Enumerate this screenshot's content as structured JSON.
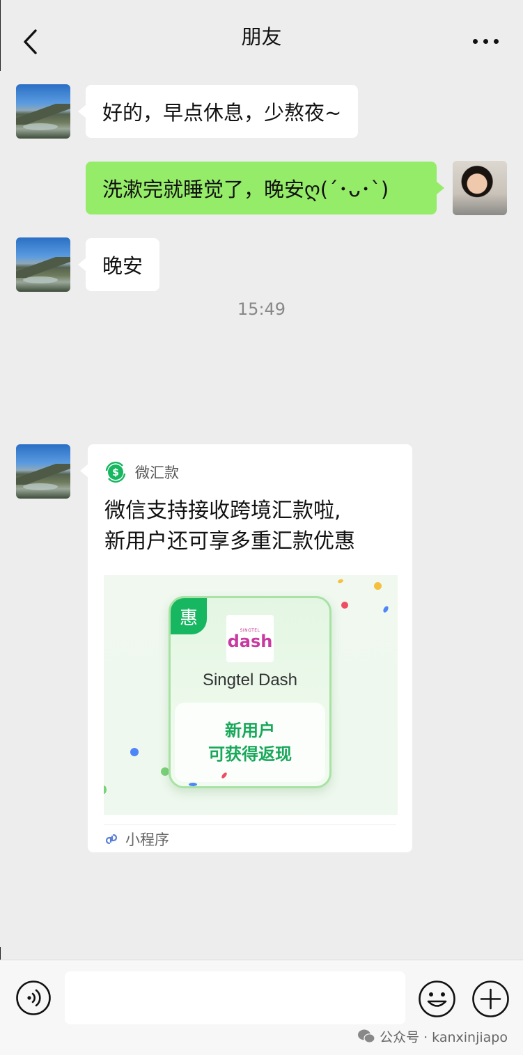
{
  "header": {
    "title": "朋友"
  },
  "messages": [
    {
      "side": "left",
      "text": "好的，早点休息，少熬夜~"
    },
    {
      "side": "right",
      "text": "洗漱完就睡觉了，晚安ღ(´･ᴗ･`)"
    },
    {
      "side": "left",
      "text": "晚安"
    }
  ],
  "timestamp": "15:49",
  "card": {
    "source": "微汇款",
    "title_line1": "微信支持接收跨境汇款啦,",
    "title_line2": "新用户还可享多重汇款优惠",
    "promo": {
      "badge": "惠",
      "logo_small": "SINGTEL",
      "logo_text": "dash",
      "name": "Singtel Dash",
      "offer_line1": "新用户",
      "offer_line2": "可获得返现"
    },
    "footer": "小程序"
  },
  "input": {
    "value": "",
    "placeholder": ""
  },
  "watermark": {
    "text": "公众号 · kanxinjiapo"
  },
  "colors": {
    "background": "#ededed",
    "bubble_self": "#95ec69",
    "bubble_other": "#ffffff",
    "wechat_green": "#17b660"
  }
}
